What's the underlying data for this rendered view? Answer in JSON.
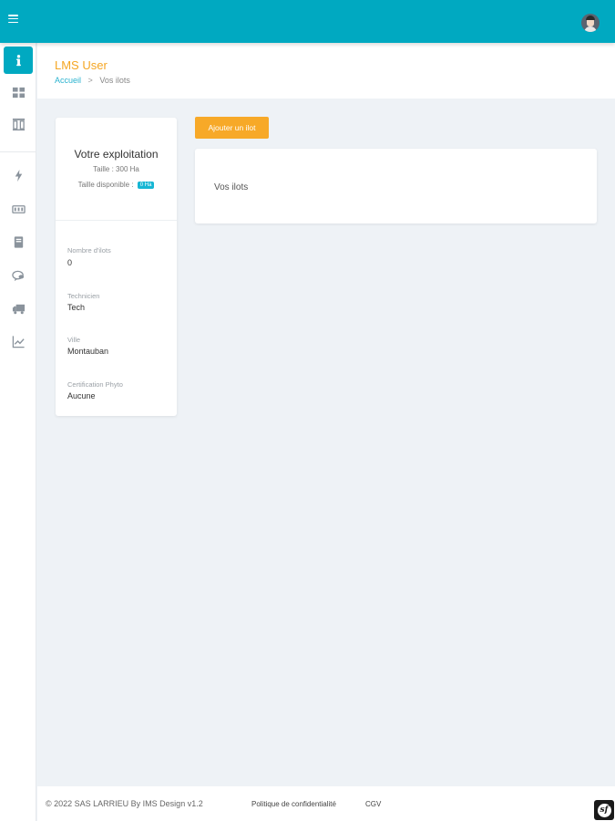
{
  "header": {
    "title": "LMS User"
  },
  "breadcrumb": {
    "home": "Accueil",
    "separator": ">",
    "current": "Vos ilots"
  },
  "sidebar": {
    "items": [
      {
        "icon": "info-icon",
        "active": true
      },
      {
        "icon": "grid-icon",
        "active": false
      },
      {
        "icon": "pillars-icon",
        "active": false
      },
      {
        "icon": "bolt-icon",
        "active": false
      },
      {
        "icon": "machine-icon",
        "active": false
      },
      {
        "icon": "book-icon",
        "active": false
      },
      {
        "icon": "chat-icon",
        "active": false
      },
      {
        "icon": "truck-icon",
        "active": false
      },
      {
        "icon": "chart-icon",
        "active": false
      }
    ]
  },
  "exploitation": {
    "title": "Votre exploitation",
    "size": "Taille : 300 Ha",
    "available_label": "Taille disponible :",
    "available_badge": "0 Ha",
    "fields": [
      {
        "label": "Nombre d'ilots",
        "value": "0"
      },
      {
        "label": "Technicien",
        "value": "Tech"
      },
      {
        "label": "Ville",
        "value": "Montauban"
      },
      {
        "label": "Certification Phyto",
        "value": "Aucune"
      }
    ]
  },
  "actions": {
    "add_ilot": "Ajouter un ilot"
  },
  "ilots": {
    "title": "Vos ilots"
  },
  "footer": {
    "copyright": "© 2022 SAS LARRIEU By IMS Design v1.2",
    "privacy": "Politique de confidentialité",
    "cgv": "CGV"
  },
  "colors": {
    "primary": "#00a9c1",
    "accent": "#f7a928",
    "background": "#eef2f6"
  }
}
